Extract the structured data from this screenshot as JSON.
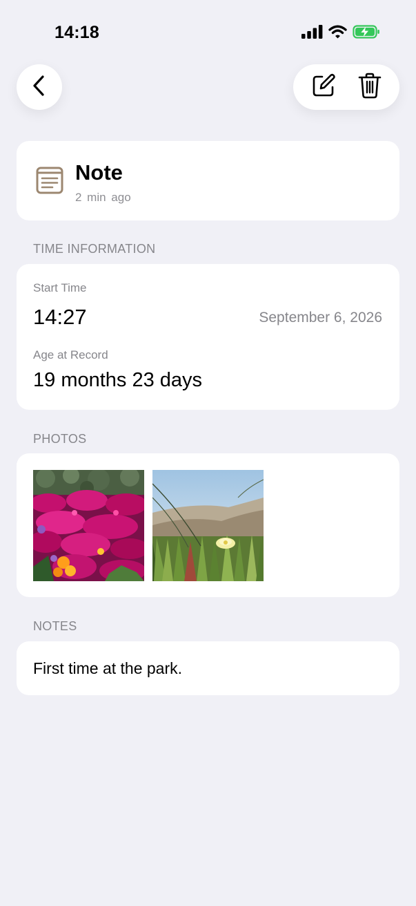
{
  "status_bar": {
    "time": "14:18",
    "icons": [
      "signal-icon",
      "wifi-icon",
      "battery-charging-icon"
    ],
    "battery_color": "#34c759"
  },
  "toolbar": {
    "back_icon": "chevron-left-icon",
    "edit_icon": "edit-note-icon",
    "delete_icon": "trash-icon"
  },
  "record": {
    "icon": "note-icon",
    "icon_color": "#9c8770",
    "title": "Note",
    "relative_time": "2 min ago"
  },
  "time_information": {
    "header": "TIME INFORMATION",
    "start_time_label": "Start Time",
    "start_time": "14:27",
    "date": "September 6, 2026",
    "age_label": "Age at Record",
    "age": "19 months 23 days"
  },
  "photos": {
    "header": "PHOTOS",
    "items": [
      "magenta-flowers-photo",
      "yellow-flower-dune-photo"
    ]
  },
  "notes": {
    "header": "NOTES",
    "text": "First time at the park."
  }
}
